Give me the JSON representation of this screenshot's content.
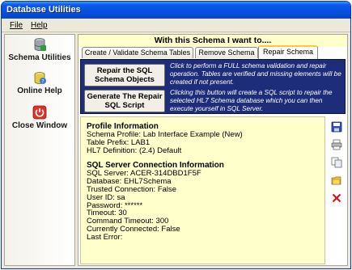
{
  "window": {
    "title": "Database Utilities"
  },
  "menu": {
    "file_label": "File",
    "help_label": "Help"
  },
  "sidebar": {
    "items": [
      {
        "label": "Schema Utilities",
        "icon": "database-icon"
      },
      {
        "label": "Online Help",
        "icon": "help-icon"
      },
      {
        "label": "Close Window",
        "icon": "power-icon"
      }
    ]
  },
  "header": {
    "title": "With this Schema I want to...."
  },
  "tabs": [
    {
      "label": "Create / Validate Schema Tables"
    },
    {
      "label": "Remove Schema"
    },
    {
      "label": "Repair Schema"
    }
  ],
  "actions": [
    {
      "button_label": "Repair the SQL Schema Objects",
      "description": "Click to perform a FULL schema validation and repair operation. Tables are verified and missing elements will be created if not present."
    },
    {
      "button_label": "Generate The Repair SQL Script",
      "description": "Clicking this button will create a SQL script to repair the selected HL7 Schema database which you can then execute yourself in SQL Server."
    }
  ],
  "info": {
    "profile_heading": "Profile Information",
    "schema_profile": "Schema Profile: Lab Interface Example (New)",
    "table_prefix": "Table Prefix: LAB1",
    "hl7_definition": "HL7 Definition: (2.4) Default",
    "sql_heading": "SQL Server Connection Information",
    "sql_server": "SQL Server: ACER-314DBD1F5F",
    "database": "Database: EHL7Schema",
    "trusted": "Trusted Connection: False",
    "user_id": "User ID: sa",
    "password": "Password: ******",
    "timeout": "Timeout: 30",
    "command_timeout": "Command Timeout: 300",
    "currently_connected": "Currently Connected: False",
    "last_error": "Last Error:"
  },
  "colors": {
    "titlebar": "#0550e0",
    "action_panel": "#1d2d7a",
    "info_background": "#ffffcc",
    "arrow": "#e00000",
    "active_tab_accent": "#ffc83c"
  },
  "toolbar_icons": [
    "save-icon",
    "print-icon",
    "copy-icon",
    "folder-icon",
    "delete-icon"
  ]
}
